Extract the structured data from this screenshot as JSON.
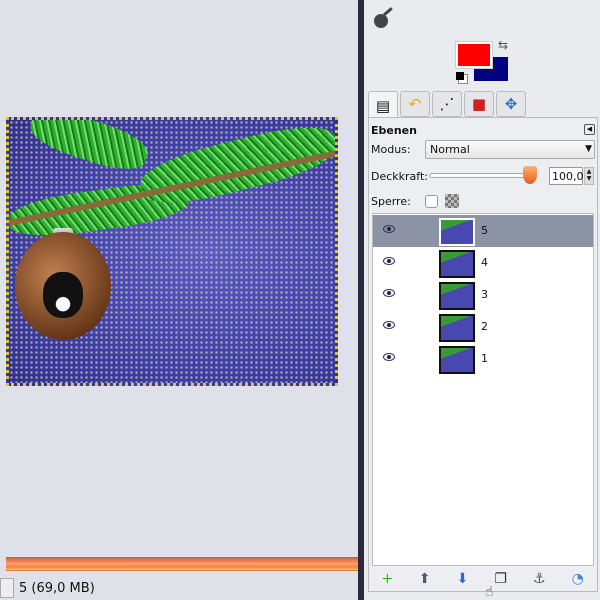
{
  "status": {
    "text": "5 (69,0 MB)"
  },
  "colors": {
    "foreground": "#ff0000",
    "background": "#000080"
  },
  "tabs": [
    {
      "icon": "layers-icon"
    },
    {
      "icon": "undo-icon"
    },
    {
      "icon": "paths-icon"
    },
    {
      "icon": "channels-icon"
    },
    {
      "icon": "move-icon"
    }
  ],
  "layers_dock": {
    "title": "Ebenen",
    "mode_label": "Modus:",
    "mode_value": "Normal",
    "opacity_label": "Deckkraft:",
    "opacity_value": "100,0",
    "opacity_percent": 100,
    "lock_label": "Sperre:",
    "layers": [
      {
        "name": "5",
        "selected": true
      },
      {
        "name": "4"
      },
      {
        "name": "3"
      },
      {
        "name": "2"
      },
      {
        "name": "1"
      }
    ]
  }
}
